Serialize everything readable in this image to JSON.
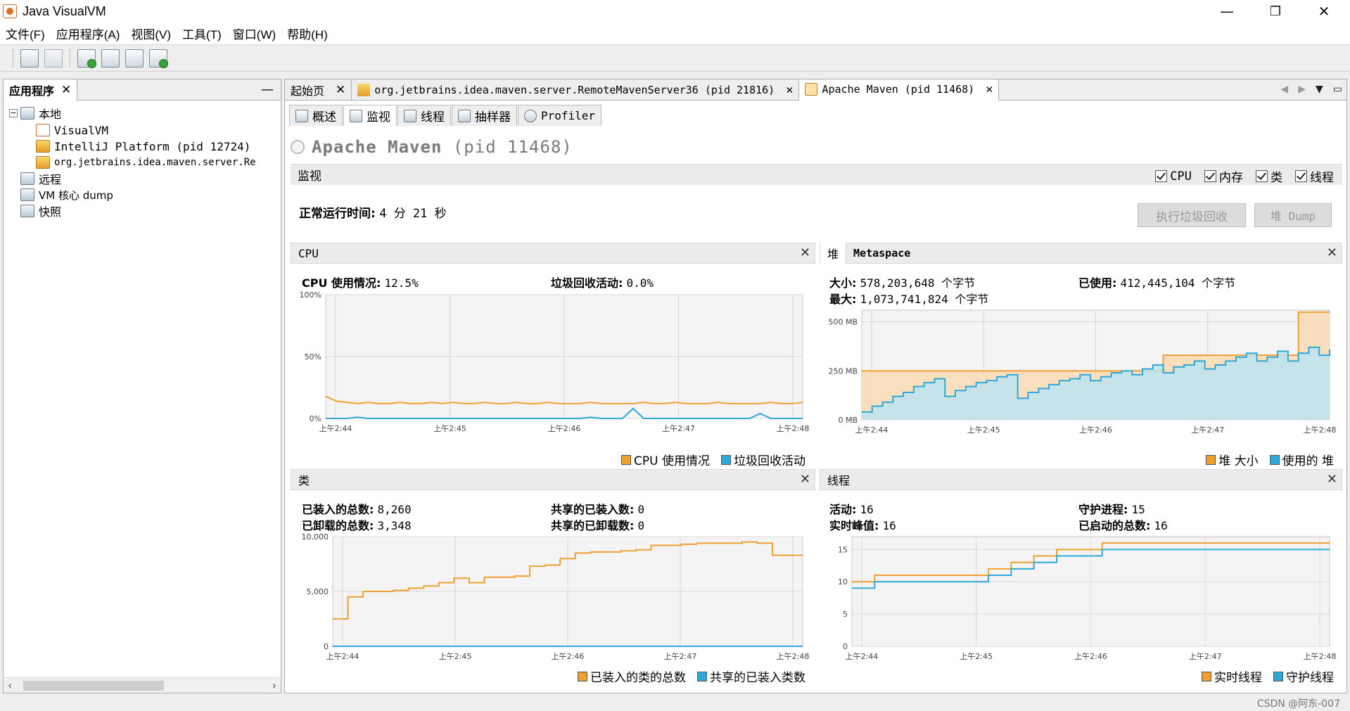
{
  "window": {
    "title": "Java VisualVM",
    "minimize": "—",
    "maximize": "❐",
    "close": "✕"
  },
  "menu": [
    "文件(F)",
    "应用程序(A)",
    "视图(V)",
    "工具(T)",
    "窗口(W)",
    "帮助(H)"
  ],
  "left_panel": {
    "tab_label": "应用程序",
    "tree": {
      "local": "本地",
      "local_children": [
        "VisualVM",
        "IntelliJ Platform (pid 12724)",
        "org.jetbrains.idea.maven.server.Re"
      ],
      "remote": "远程",
      "vm_dump": "VM 核心 dump",
      "snapshots": "快照"
    }
  },
  "doc_tabs": [
    {
      "label": "起始页"
    },
    {
      "label": "org.jetbrains.idea.maven.server.RemoteMavenServer36 (pid 21816)"
    },
    {
      "label": "Apache Maven (pid 11468)"
    }
  ],
  "sub_tabs": [
    "概述",
    "监视",
    "线程",
    "抽样器",
    "Profiler"
  ],
  "app": {
    "name": "Apache Maven",
    "pid": "(pid 11468)"
  },
  "monitor": {
    "section": "监视",
    "checkboxes": [
      "CPU",
      "内存",
      "类",
      "线程"
    ],
    "uptime_label": "正常运行时间:",
    "uptime_value": "4 分 21 秒",
    "gc_button": "执行垃圾回收",
    "dump_button": "堆 Dump"
  },
  "cpu_panel": {
    "title": "CPU",
    "usage_label": "CPU 使用情况:",
    "usage_value": "12.5%",
    "gc_label": "垃圾回收活动:",
    "gc_value": "0.0%",
    "legend": [
      "CPU 使用情况",
      "垃圾回收活动"
    ]
  },
  "heap_panel": {
    "tab_heap": "堆",
    "tab_metaspace": "Metaspace",
    "size_label": "大小:",
    "size_value": "578,203,648 个字节",
    "used_label": "已使用:",
    "used_value": "412,445,104 个字节",
    "max_label": "最大:",
    "max_value": "1,073,741,824 个字节",
    "legend": [
      "堆 大小",
      "使用的 堆"
    ]
  },
  "classes_panel": {
    "title": "类",
    "loaded_label": "已装入的总数:",
    "loaded_value": "8,260",
    "unloaded_label": "已卸载的总数:",
    "unloaded_value": "3,348",
    "shared_loaded_label": "共享的已装入数:",
    "shared_loaded_value": "0",
    "shared_unloaded_label": "共享的已卸载数:",
    "shared_unloaded_value": "0",
    "legend": [
      "已装入的类的总数",
      "共享的已装入类数"
    ]
  },
  "threads_panel": {
    "title": "线程",
    "live_label": "活动:",
    "live_value": "16",
    "daemon_label": "守护进程:",
    "daemon_value": "15",
    "peak_label": "实时峰值:",
    "peak_value": "16",
    "started_label": "已启动的总数:",
    "started_value": "16",
    "legend": [
      "实时线程",
      "守护线程"
    ]
  },
  "colors": {
    "orange": "#f0a030",
    "blue": "#2ea8d8",
    "orange_fill": "#fbd9b0",
    "blue_fill": "#b8e4f4"
  },
  "chart_data": [
    {
      "type": "line",
      "name": "cpu",
      "x_ticks": [
        "上午2:44",
        "上午2:45",
        "上午2:46",
        "上午2:47",
        "上午2:48"
      ],
      "y_ticks": [
        "100%",
        "50%",
        "0%"
      ],
      "ylim": [
        0,
        100
      ],
      "series": [
        {
          "name": "CPU 使用情况",
          "values": [
            18,
            14,
            13,
            12,
            13,
            12,
            12,
            13,
            12,
            12,
            13,
            12,
            13,
            12,
            12,
            13,
            12,
            12,
            13,
            12,
            12,
            13,
            12,
            12,
            12,
            13,
            12,
            12,
            12,
            12,
            13,
            12,
            12,
            13,
            12,
            12,
            12,
            13,
            12,
            12,
            12,
            12,
            13,
            12,
            12,
            13
          ]
        },
        {
          "name": "垃圾回收活动",
          "values": [
            0,
            0,
            0,
            1,
            0,
            0,
            0,
            0,
            0,
            0,
            0,
            0,
            0,
            0,
            0,
            0,
            0,
            0,
            0,
            0,
            0,
            0,
            0,
            0,
            0,
            1,
            0,
            0,
            0,
            8,
            0,
            0,
            0,
            0,
            0,
            0,
            0,
            0,
            0,
            0,
            0,
            4,
            0,
            0,
            0,
            0
          ]
        }
      ]
    },
    {
      "type": "area",
      "name": "heap",
      "x_ticks": [
        "上午2:44",
        "上午2:45",
        "上午2:46",
        "上午2:47",
        "上午2:48"
      ],
      "y_ticks": [
        "500 MB",
        "250 MB",
        "0 MB"
      ],
      "ylim": [
        0,
        560
      ],
      "series": [
        {
          "name": "堆 大小",
          "values": [
            250,
            250,
            250,
            250,
            250,
            250,
            250,
            250,
            250,
            250,
            250,
            250,
            250,
            250,
            250,
            250,
            250,
            250,
            250,
            250,
            250,
            250,
            250,
            250,
            250,
            250,
            250,
            250,
            250,
            330,
            330,
            330,
            330,
            330,
            330,
            330,
            330,
            330,
            330,
            330,
            330,
            330,
            550,
            550,
            550,
            550
          ]
        },
        {
          "name": "使用的 堆",
          "values": [
            40,
            70,
            90,
            120,
            140,
            170,
            190,
            210,
            120,
            150,
            170,
            190,
            200,
            220,
            230,
            110,
            140,
            160,
            180,
            200,
            210,
            230,
            200,
            220,
            240,
            250,
            230,
            260,
            280,
            240,
            270,
            280,
            300,
            260,
            280,
            300,
            320,
            340,
            300,
            320,
            350,
            300,
            340,
            370,
            330,
            360
          ]
        }
      ]
    },
    {
      "type": "line",
      "name": "classes",
      "x_ticks": [
        "上午2:44",
        "上午2:45",
        "上午2:46",
        "上午2:47",
        "上午2:48"
      ],
      "y_ticks": [
        "10,000",
        "5,000",
        "0"
      ],
      "ylim": [
        0,
        10000
      ],
      "series": [
        {
          "name": "已装入的类的总数",
          "values": [
            2500,
            4500,
            5000,
            5000,
            5100,
            5300,
            5500,
            5800,
            6200,
            5800,
            6300,
            6300,
            6400,
            7300,
            7400,
            8000,
            8500,
            8600,
            8600,
            8700,
            8800,
            9200,
            9200,
            9300,
            9400,
            9400,
            9400,
            9500,
            9400,
            8300,
            8300,
            8300
          ]
        },
        {
          "name": "共享的已装入类数",
          "values": [
            0,
            0,
            0,
            0,
            0,
            0,
            0,
            0,
            0,
            0,
            0,
            0,
            0,
            0,
            0,
            0,
            0,
            0,
            0,
            0,
            0,
            0,
            0,
            0,
            0,
            0,
            0,
            0,
            0,
            0,
            0,
            0
          ]
        }
      ]
    },
    {
      "type": "line",
      "name": "threads",
      "x_ticks": [
        "上午2:44",
        "上午2:45",
        "上午2:46",
        "上午2:47",
        "上午2:48"
      ],
      "y_ticks": [
        "15",
        "10",
        "5",
        "0"
      ],
      "ylim": [
        0,
        17
      ],
      "series": [
        {
          "name": "实时线程",
          "values": [
            10,
            11,
            11,
            11,
            11,
            11,
            12,
            13,
            14,
            15,
            15,
            16,
            16,
            16,
            16,
            16,
            16,
            16,
            16,
            16,
            16,
            16
          ]
        },
        {
          "name": "守护线程",
          "values": [
            9,
            10,
            10,
            10,
            10,
            10,
            11,
            12,
            13,
            14,
            14,
            15,
            15,
            15,
            15,
            15,
            15,
            15,
            15,
            15,
            15,
            15
          ]
        }
      ]
    }
  ],
  "watermark": "CSDN @阿东-007"
}
